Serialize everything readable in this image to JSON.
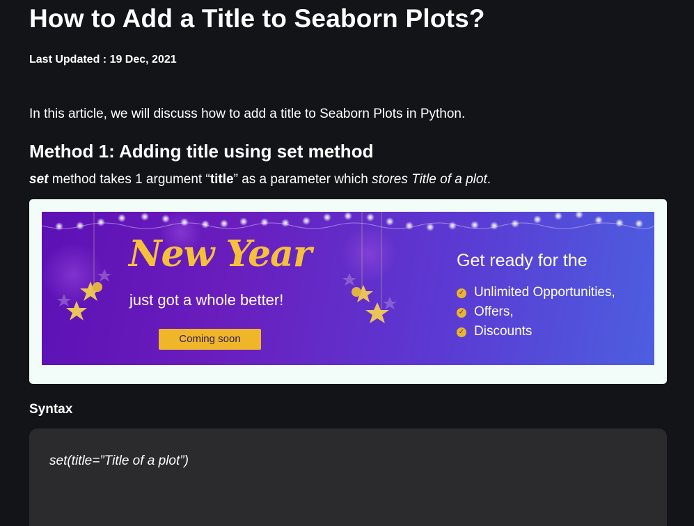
{
  "article": {
    "title": "How to Add a Title to Seaborn Plots?",
    "last_updated": "Last Updated : 19 Dec, 2021",
    "intro": "In this article, we will discuss how to add a title to Seaborn Plots in Python.",
    "method1": {
      "heading": "Method 1: Adding title using set method",
      "desc_term": "set",
      "desc_part1": " method takes 1 argument “",
      "desc_arg": "title",
      "desc_part2": "” as a parameter which ",
      "desc_italic": "stores Title of a plot",
      "desc_end": "."
    },
    "syntax_label": "Syntax",
    "syntax_code": "set(title=”Title of a plot”)"
  },
  "ad": {
    "headline": "New Year",
    "subline": "just got a whole better!",
    "button": "Coming soon",
    "right_title": "Get ready for the",
    "bullets": [
      "Unlimited Opportunities,",
      "Offers,",
      "Discounts"
    ],
    "colors": {
      "frame": "#f2fdf9",
      "headline": "#f5c13a",
      "button": "#f0b629",
      "gradient_start": "#5c11b5",
      "gradient_end": "#4c5fe0"
    }
  },
  "colors": {
    "background": "#131417",
    "code_background": "#2b2b2d",
    "text": "#ffffff"
  }
}
